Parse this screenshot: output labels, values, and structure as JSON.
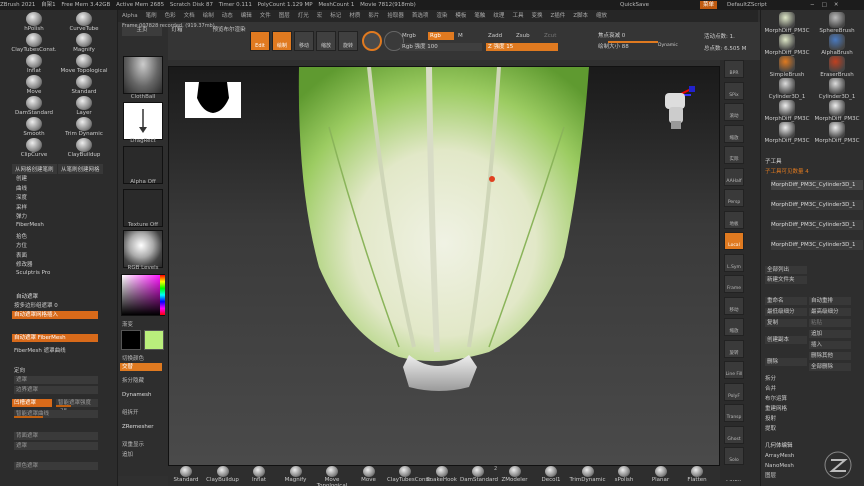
{
  "titlebar": {
    "app": "ZBrush 2021",
    "items": [
      "自架1",
      "Free Mem 3.42GB",
      "Active Mem 2685",
      "Scratch Disk 87",
      "Timer 0.111",
      "PolyCount 1.129 MP",
      "MeshCount 1",
      "Movie 7812(918mb)"
    ],
    "quicksave": "QuickSave",
    "menus_label": "菜单",
    "script": "DefaultZScript"
  },
  "menubar": [
    "Alpha",
    "笔刷",
    "色彩",
    "文档",
    "绘制",
    "动态",
    "编辑",
    "文件",
    "图层",
    "灯光",
    "宏",
    "标记",
    "材质",
    "影片",
    "拾取器",
    "首选项",
    "渲染",
    "模板",
    "笔触",
    "纹理",
    "工具",
    "变换",
    "Z插件",
    "Z脚本",
    "缩放"
  ],
  "frame_info": "Frame 007828 recorded, (919.37mb)",
  "left_brushes": [
    {
      "label": "hPolish"
    },
    {
      "label": "CurveTube"
    },
    {
      "label": "ClayTubesConst."
    },
    {
      "label": "Magnify"
    },
    {
      "label": "Inflat"
    },
    {
      "label": "Move Topological"
    },
    {
      "label": "Move"
    },
    {
      "label": "Standard"
    },
    {
      "label": "DamStandard"
    },
    {
      "label": "Layer"
    },
    {
      "label": "Smooth"
    },
    {
      "label": "Trim Dynamic"
    },
    {
      "label": "ClipCurve"
    },
    {
      "label": "ClayBuildup"
    }
  ],
  "left_buttons": [
    "从网格创建笔刷",
    "从笔刷创建网格"
  ],
  "left_menu": [
    "创建",
    "曲线",
    "深度",
    "采样",
    "弹力",
    "FiberMesh",
    "拾色",
    "方位",
    "表面",
    "修改器",
    "Sculptris Pro"
  ],
  "automask": {
    "header": "自动遮罩",
    "mask_by_polygroups": "按多边形组遮罩 0",
    "mask_mesh_insert": "自动遮罩网格插入",
    "mask_fibermesh": "自动遮罩 FiberMesh",
    "fibermesh_mask_curve": "FiberMesh 遮罩曲线",
    "direction": "定向",
    "direction2": "遮罩"
  },
  "left_sliders": [
    {
      "label": "遮罩",
      "fill": 0.0
    },
    {
      "label": "边界遮罩",
      "fill": 0.0
    },
    {
      "label": "凹槽遮罩",
      "fill": 0.0
    },
    {
      "label": "智能遮罩强度 -28",
      "fill": 0.35
    },
    {
      "label": "智能遮罩曲线",
      "fill": 0.0
    },
    {
      "label": "背面遮罩",
      "fill": 0.0
    },
    {
      "label": "遮罩",
      "fill": 0.0
    },
    {
      "label": "颜色遮罩",
      "fill": 0.0
    }
  ],
  "midtray": {
    "clothball": "ClothBall",
    "dragrect": "DragRect",
    "alpha_off": "Alpha Off",
    "texture_off": "Texture Off",
    "material": "RGB Levels",
    "gradient": "渐变",
    "switch_color": "切换颜色",
    "alternate": "交替",
    "swap_hide": "拆分隐藏",
    "dynamesh": "Dynamesh",
    "split": "组拆开",
    "zremesher": "ZRemesher",
    "double": "双重显示",
    "add": "追加"
  },
  "toolbar": {
    "home": "主页",
    "lightbox": "灯箱",
    "boolean": "预览布尔渲染",
    "edit": "Edit",
    "draw": "绘制",
    "move": "移动",
    "scale": "缩放",
    "rotate": "旋转",
    "mrgb": "Mrgb",
    "rgb": "Rgb",
    "m": "M",
    "rgb_intensity": "Rgb 强度 100",
    "zadd": "Zadd",
    "zsub": "Zsub",
    "zcut": "Zcut",
    "z_intensity": "Z 强度 15",
    "focal": "焦点衰减 0",
    "draw_size": "绘制大小 88",
    "dynamic": "Dynamic",
    "active_points": "活动点数: 1.",
    "total_points": "总点数: 6.505 M"
  },
  "bottom_brushes": [
    "Standard",
    "ClayBuildup",
    "Inflat",
    "Magnify",
    "Move Topological",
    "Move",
    "ClayTubesConst.",
    "SnakeHook",
    "DamStandard",
    "ZModeler",
    "Decol1",
    "TrimDynamic",
    "sPolish",
    "Planar",
    "Flatten",
    "Pinch"
  ],
  "bottom_badge": "2",
  "right_strip": [
    "BPR",
    "SPix",
    "滚动",
    "缩放",
    "实际",
    "AAHalf",
    "Persp",
    "地板",
    "Local",
    "L.Sym",
    "Frame",
    "移动",
    "缩放",
    "旋转",
    "Line Fill",
    "PolyF",
    "Transp",
    "Ghost",
    "Solo"
  ],
  "right_panel": {
    "tools": [
      "MorphDiff_PM3C",
      "SphereBrush",
      "MorphDiff_PM3C",
      "AlphaBrush",
      "SimpleBrush",
      "EraserBrush",
      "Cylinder3D_1",
      "Cylinder3D_1",
      "MorphDiff_PM3C",
      "MorphDiff_PM3C",
      "MorphDiff_PM3C",
      "MorphDiff_PM3C"
    ],
    "subtool_header": "子工具",
    "subtool_visible": "子工具可见数量 4",
    "subtools": [
      "MorphDiff_PM3C_Cylinder3D_1",
      "MorphDiff_PM3C_Cylinder3D_1",
      "MorphDiff_PM3C_Cylinder3D_1",
      "MorphDiff_PM3C_Cylinder3D_1"
    ],
    "list_all": "全部列出",
    "new_folder": "新建文件夹",
    "rename": "重命名",
    "auto_rename": "自动重排",
    "min_subdiv": "最低级细分",
    "max_subdiv": "最高级细分",
    "copy": "复制",
    "paste": "粘贴",
    "create_copy": "创建副本",
    "append": "追加",
    "insert": "插入",
    "delete": "删除",
    "delete_other": "删除其他",
    "delete_all": "全部删除",
    "split": "拆分",
    "merge": "合并",
    "boolean": "布尔运算",
    "remesh": "重建网格",
    "project": "投射",
    "extract": "提取",
    "geom_header": "几何体编辑",
    "arraymesh": "ArrayMesh",
    "nanomesh": "NanoMesh",
    "layers": "图层"
  },
  "colors": {
    "accent": "#e07a20",
    "cabbage_light": "#eef0e0",
    "cabbage_green": "#7fc04a"
  }
}
